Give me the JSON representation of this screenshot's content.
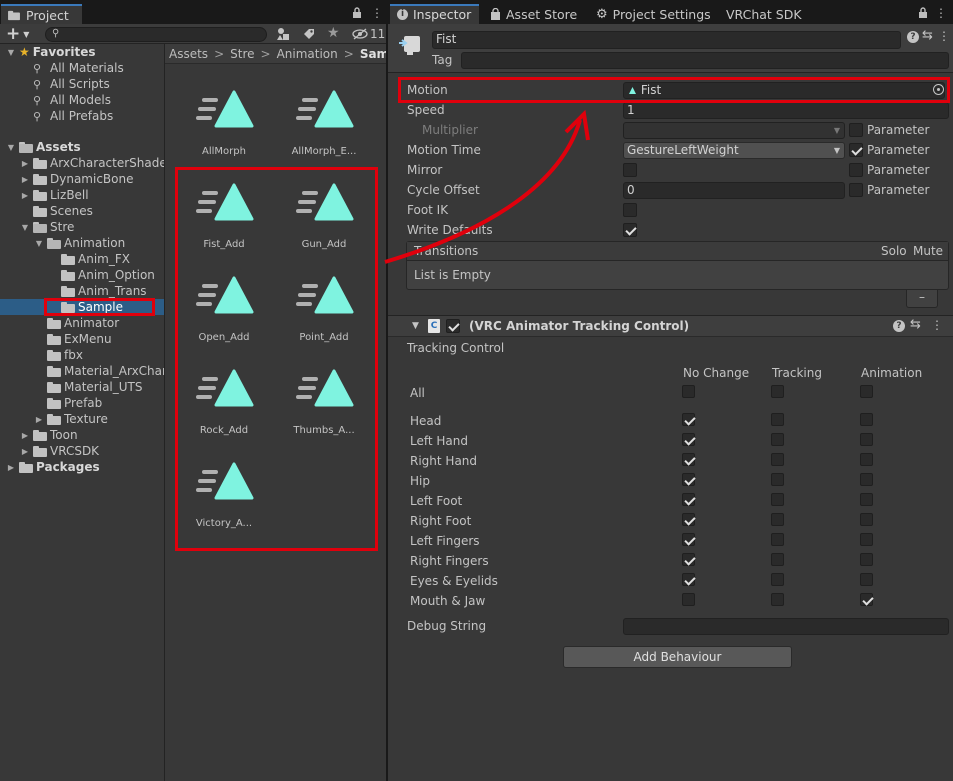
{
  "project_panel": {
    "tab_label": "Project",
    "add_label": "+",
    "hidden_count": "11",
    "favorites": {
      "label": "Favorites",
      "items": [
        "All Materials",
        "All Scripts",
        "All Models",
        "All Prefabs"
      ]
    },
    "assets_label": "Assets",
    "tree": [
      {
        "label": "ArxCharacterShaders",
        "depth": 1,
        "arrow": "right",
        "open": false
      },
      {
        "label": "DynamicBone",
        "depth": 1,
        "arrow": "right",
        "open": false
      },
      {
        "label": "LizBell",
        "depth": 1,
        "arrow": "right",
        "open": false
      },
      {
        "label": "Scenes",
        "depth": 1,
        "arrow": "none",
        "open": false
      },
      {
        "label": "Stre",
        "depth": 1,
        "arrow": "down",
        "open": true
      },
      {
        "label": "Animation",
        "depth": 2,
        "arrow": "down",
        "open": true
      },
      {
        "label": "Anim_FX",
        "depth": 3,
        "arrow": "none",
        "open": false
      },
      {
        "label": "Anim_Option",
        "depth": 3,
        "arrow": "none",
        "open": false
      },
      {
        "label": "Anim_Trans",
        "depth": 3,
        "arrow": "none",
        "open": false
      },
      {
        "label": "Sample",
        "depth": 3,
        "arrow": "none",
        "open": false,
        "selected": true
      },
      {
        "label": "Animator",
        "depth": 2,
        "arrow": "none",
        "open": false
      },
      {
        "label": "ExMenu",
        "depth": 2,
        "arrow": "none",
        "open": false
      },
      {
        "label": "fbx",
        "depth": 2,
        "arrow": "none",
        "open": false
      },
      {
        "label": "Material_ArxCharacterShaders",
        "depth": 2,
        "arrow": "none",
        "open": false
      },
      {
        "label": "Material_UTS",
        "depth": 2,
        "arrow": "none",
        "open": false
      },
      {
        "label": "Prefab",
        "depth": 2,
        "arrow": "none",
        "open": false
      },
      {
        "label": "Texture",
        "depth": 2,
        "arrow": "right",
        "open": false
      },
      {
        "label": "Toon",
        "depth": 1,
        "arrow": "right",
        "open": false
      },
      {
        "label": "VRCSDK",
        "depth": 1,
        "arrow": "right",
        "open": false
      }
    ],
    "packages_label": "Packages",
    "breadcrumb": [
      "Assets",
      "Stre",
      "Animation",
      "Sample"
    ],
    "assets": [
      "AllMorph",
      "AllMorph_E...",
      "Fist_Add",
      "Gun_Add",
      "Open_Add",
      "Point_Add",
      "Rock_Add",
      "Thumbs_A...",
      "Victory_A..."
    ]
  },
  "tabs": [
    "Inspector",
    "Asset Store",
    "Project Settings",
    "VRChat SDK"
  ],
  "inspector": {
    "name_value": "Fist",
    "tag_label": "Tag",
    "motion_label": "Motion",
    "motion_value": "Fist",
    "speed_label": "Speed",
    "speed_value": "1",
    "multiplier_label": "Multiplier",
    "motion_time_label": "Motion Time",
    "motion_time_value": "GestureLeftWeight",
    "mirror_label": "Mirror",
    "cycle_offset_label": "Cycle Offset",
    "cycle_offset_value": "0",
    "foot_ik_label": "Foot IK",
    "write_defaults_label": "Write Defaults",
    "write_defaults_checked": true,
    "parameter_label": "Parameter",
    "transitions": {
      "header": "Transitions",
      "solo": "Solo",
      "mute": "Mute",
      "empty": "List is Empty",
      "remove_label": "–"
    },
    "component_title": "(VRC Animator Tracking Control)",
    "tracking_control_label": "Tracking Control",
    "columns": [
      "No Change",
      "Tracking",
      "Animation"
    ],
    "tracking_rows": [
      {
        "label": "All",
        "state": "none"
      },
      {
        "label": "Head",
        "state": "no_change"
      },
      {
        "label": "Left Hand",
        "state": "no_change"
      },
      {
        "label": "Right Hand",
        "state": "no_change"
      },
      {
        "label": "Hip",
        "state": "no_change"
      },
      {
        "label": "Left Foot",
        "state": "no_change"
      },
      {
        "label": "Right Foot",
        "state": "no_change"
      },
      {
        "label": "Left Fingers",
        "state": "no_change"
      },
      {
        "label": "Right Fingers",
        "state": "no_change"
      },
      {
        "label": "Eyes & Eyelids",
        "state": "no_change"
      },
      {
        "label": "Mouth & Jaw",
        "state": "animation"
      }
    ],
    "debug_string_label": "Debug String",
    "add_behaviour_label": "Add Behaviour"
  },
  "colors": {
    "highlight": "#e0000c",
    "selection": "#2c5d87",
    "anim_icon": "#7ff3e0"
  }
}
